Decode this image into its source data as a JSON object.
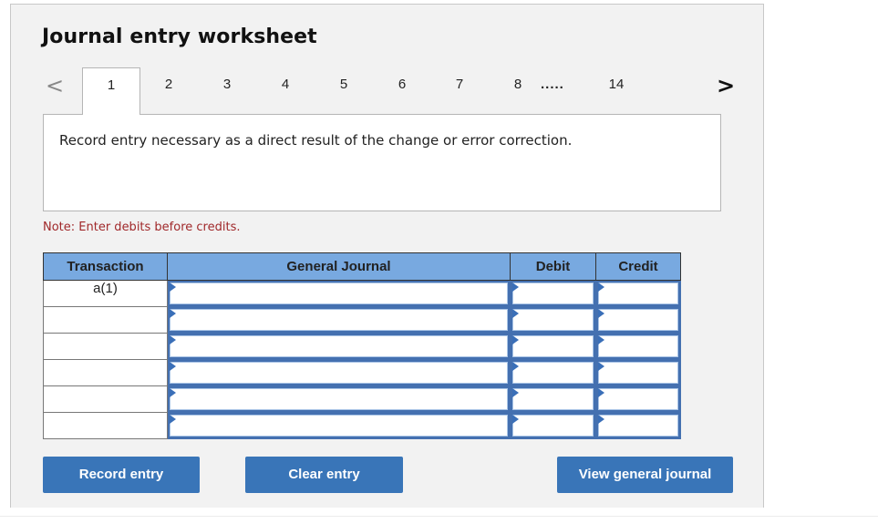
{
  "title": "Journal entry worksheet",
  "pagination": {
    "prev_icon": "chevron-left-icon",
    "next_icon": "chevron-right-icon",
    "prev_glyph": "<",
    "next_glyph": ">",
    "active": "1",
    "tabs": [
      "1",
      "2",
      "3",
      "4",
      "5",
      "6",
      "7",
      "8",
      "14"
    ],
    "ellipsis": "....."
  },
  "description": "Record entry necessary as a direct result of the change or error correction.",
  "note": "Note: Enter debits before credits.",
  "table": {
    "headers": {
      "transaction": "Transaction",
      "general_journal": "General Journal",
      "debit": "Debit",
      "credit": "Credit"
    },
    "rows": [
      {
        "transaction": "a(1)",
        "account": "",
        "debit": "",
        "credit": ""
      },
      {
        "transaction": "",
        "account": "",
        "debit": "",
        "credit": ""
      },
      {
        "transaction": "",
        "account": "",
        "debit": "",
        "credit": ""
      },
      {
        "transaction": "",
        "account": "",
        "debit": "",
        "credit": ""
      },
      {
        "transaction": "",
        "account": "",
        "debit": "",
        "credit": ""
      },
      {
        "transaction": "",
        "account": "",
        "debit": "",
        "credit": ""
      }
    ]
  },
  "buttons": {
    "record": "Record entry",
    "clear": "Clear entry",
    "view": "View general journal"
  },
  "colors": {
    "header_bg": "#78a9e0",
    "button_bg": "#3975b8",
    "note_text": "#a0282a",
    "input_border": "#4470b0"
  }
}
